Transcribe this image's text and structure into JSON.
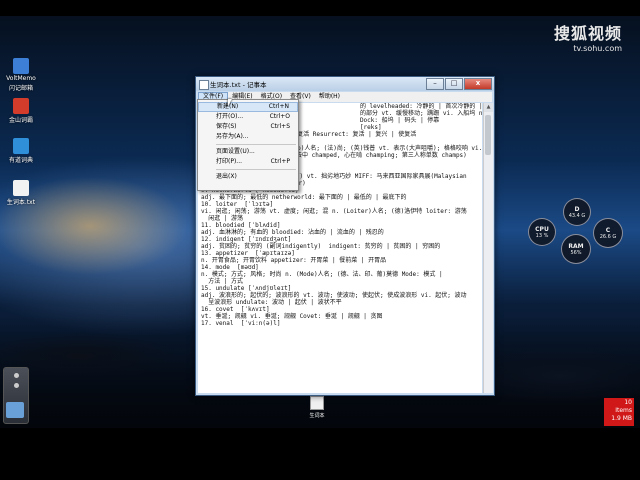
{
  "watermark": {
    "title": "搜狐视频",
    "url": "tv.sohu.com"
  },
  "desktop_icons": [
    {
      "label": "VoltMemo",
      "label2": "闪记邮箱",
      "color": "#3d7fd6"
    },
    {
      "label": "金山词霸",
      "label2": "",
      "color": "#d33b2a"
    },
    {
      "label": "有道词典",
      "label2": "",
      "color": "#2f8fd8"
    },
    {
      "label": "生词本.txt",
      "label2": "",
      "color": "#f2f2f2"
    }
  ],
  "window": {
    "title": "生词本.txt - 记事本",
    "controls": {
      "minimize": "–",
      "maximize": "□",
      "close": "x"
    }
  },
  "menubar": [
    "文件(F)",
    "编辑(E)",
    "格式(O)",
    "查看(V)",
    "帮助(H)"
  ],
  "file_menu": [
    {
      "label": "新建(N)",
      "shortcut": "Ctrl+N",
      "state": "hover"
    },
    {
      "label": "打开(O)...",
      "shortcut": "Ctrl+O",
      "state": "normal"
    },
    {
      "label": "保存(S)",
      "shortcut": "Ctrl+S",
      "state": "normal"
    },
    {
      "label": "另存为(A)...",
      "shortcut": "",
      "state": "normal"
    },
    {
      "label": "页面设置(U)...",
      "shortcut": "",
      "state": "normal",
      "separator_before": true
    },
    {
      "label": "打印(P)...",
      "shortcut": "Ctrl+P",
      "state": "normal"
    },
    {
      "label": "退出(X)",
      "shortcut": "",
      "state": "normal",
      "separator_before": true
    }
  ],
  "editor_lines": [
    "",
    "",
    "",
    "                                            的 levelheaded: 冷静的 | 首次冷静的 | 镇定的",
    "                                            的部分 vt. 缓慢移动; 蹒跚 vi. 入船坞 n. (Dock)人名",
    "                                            Dock: 船坞 | 码头 | 停靠",
    "                                            [reks]",
    "5. vi 使变清; 复兴; 拉出 vt. 复活 Resurrect: 复活 | 复兴 | 使复活",
    "6. champ [tʃæmp]",
    "vt. 咀嚼; 咬得格格响 n. (Champ)人名; (法)尚; (英)钱普 vt. 表示(大声咀嚼); 格格咬响 vi.",
    "n. 冠军; (法)尚; champed, 咀去中 champed, 心在啃 champing; 第三人称单数 champs)",
    "Champ: 冠军 | 优胜 | 强者",
    "7. naff   [næf]",
    "8. 马来西亚国际家具展 (缩写MIFF) vt. 拙劣地巧妙 MIFF: 马来西亚国际家具展(Malaysian",
    "International Furniture Fair)",
    "9. netherworld [ˈneðəwɜːld]",
    "adj. 最下面的; 最低的 netherworld: 最下面的 | 最低的 | 最底下的",
    "10. loiter  [ˈlɔɪtə]",
    "vi. 闲逛; 闲荡; 游荡 vt. 虚度; 闲逛; 混 n. (Loiter)人名; (德)洛伊特 loiter: 游荡",
    "  闲逛 | 游荡",
    "11. bloodied [ˈblʌdid]",
    "adj. 血淋淋的; 有血的 bloodied: 沾血的 | 流血的 | 残忍的",
    "12. indigent [ˈɪndɪdʒənt]",
    "adj. 贫困的; 贫穷的 (副词indigently)  indigent: 贫穷的 | 贫困的 | 穷困的",
    "13. appetizer  [ˈæpɪtaɪzə]",
    "n. 开胃食品; 开胃饮料 appetizer: 开胃菜 | 餐前菜 | 开胃品",
    "14. mode  [məʊd]",
    "n. 模式; 方式; 风格; 时尚 n. (Mode)人名; (德、法、印、葡)莫德 Mode: 模式 |",
    "  方法 | 方式",
    "15. undulate [ˈʌndjʊleɪt]",
    "adj. 波浪形的; 起伏的; 波浪形的 vt. 波动; 使波动; 使起伏; 使成波浪形 vi. 起伏; 波动",
    "  呈波浪形 undulate: 波动 | 起伏 | 波状不平",
    "16. covet  [ˈkʌvɪt]",
    "vt. 垂涎; 觊觎 vi. 垂涎; 觊觎 Covet: 垂涎 | 觊觎 | 贪图",
    "17. venal  [ˈviːn(ə)l]"
  ],
  "gauges": [
    {
      "label": "CPU",
      "value": "13 %"
    },
    {
      "label": "RAM",
      "value": "56%"
    },
    {
      "label": "D",
      "value": "43.4 G"
    },
    {
      "label": "C",
      "value": "26.6 G"
    }
  ],
  "memory_badge": {
    "line1": "10",
    "line2": "Items",
    "line3": "1.9 MB"
  },
  "taskbar_file": {
    "label": "生词本"
  }
}
